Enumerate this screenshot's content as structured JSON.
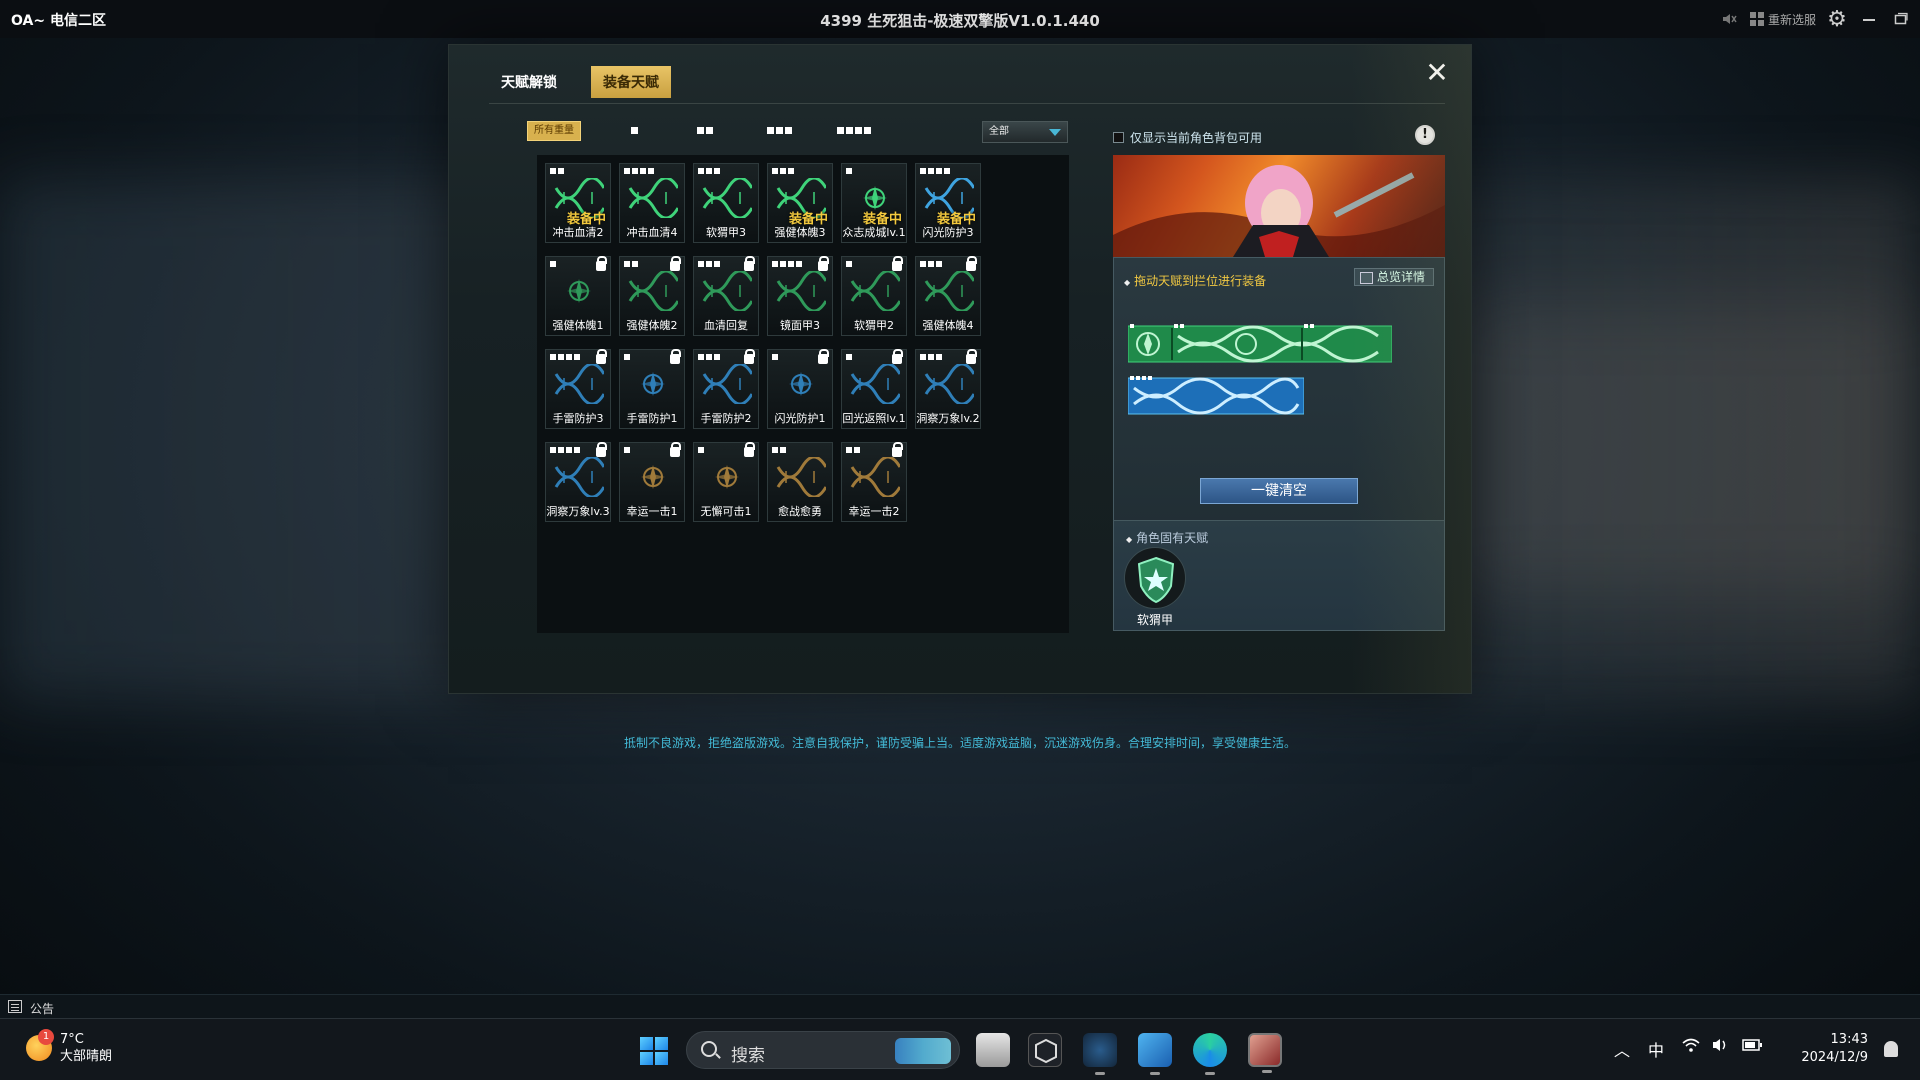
{
  "titlebar": {
    "server": "OA~ 电信二区",
    "title": "4399 生死狙击-极速双擎版V1.0.1.440",
    "reselect": "重新选服",
    "icons": [
      "mute-icon",
      "grid-icon",
      "gear-icon",
      "minimize-icon",
      "restore-icon"
    ]
  },
  "dialog": {
    "tabs": [
      {
        "label": "天赋解锁",
        "active": false
      },
      {
        "label": "装备天赋",
        "active": true
      }
    ],
    "close": "✕",
    "filter_all": "所有重量",
    "filter_levels": [
      1,
      2,
      3,
      4
    ],
    "select_value": "全部",
    "checkbox_label": "仅显示当前角色背包可用",
    "equipped_label": "装备中",
    "talents": [
      {
        "name": "冲击血清2",
        "level": 2,
        "equipped": true,
        "locked": false,
        "shape": "helix",
        "color": "#3fd37a"
      },
      {
        "name": "冲击血清4",
        "level": 4,
        "equipped": false,
        "locked": false,
        "shape": "helix",
        "color": "#3fd37a"
      },
      {
        "name": "软猬甲3",
        "level": 3,
        "equipped": false,
        "locked": false,
        "shape": "helix",
        "color": "#3fd37a"
      },
      {
        "name": "强健体魄3",
        "level": 3,
        "equipped": true,
        "locked": false,
        "shape": "helix",
        "color": "#3fd37a"
      },
      {
        "name": "众志成城lv.1",
        "level": 1,
        "equipped": true,
        "locked": false,
        "shape": "gear",
        "color": "#3fd37a"
      },
      {
        "name": "闪光防护3",
        "level": 4,
        "equipped": true,
        "locked": false,
        "shape": "helix",
        "color": "#3fa4e0"
      },
      {
        "name": "强健体魄1",
        "level": 1,
        "equipped": false,
        "locked": true,
        "shape": "gear",
        "color": "#2f9a5a"
      },
      {
        "name": "强健体魄2",
        "level": 2,
        "equipped": false,
        "locked": true,
        "shape": "helix",
        "color": "#2f9a5a"
      },
      {
        "name": "血清回复",
        "level": 3,
        "equipped": false,
        "locked": true,
        "shape": "helix",
        "color": "#2f9a5a"
      },
      {
        "name": "镜面甲3",
        "level": 4,
        "equipped": false,
        "locked": true,
        "shape": "helix",
        "color": "#2f9a5a"
      },
      {
        "name": "软猬甲2",
        "level": 1,
        "equipped": false,
        "locked": true,
        "shape": "helix",
        "color": "#2f9a5a"
      },
      {
        "name": "强健体魄4",
        "level": 3,
        "equipped": false,
        "locked": true,
        "shape": "helix",
        "color": "#2f9a5a"
      },
      {
        "name": "手雷防护3",
        "level": 4,
        "equipped": false,
        "locked": true,
        "shape": "helix",
        "color": "#2f7fb8"
      },
      {
        "name": "手雷防护1",
        "level": 1,
        "equipped": false,
        "locked": true,
        "shape": "gear",
        "color": "#2f7fb8"
      },
      {
        "name": "手雷防护2",
        "level": 3,
        "equipped": false,
        "locked": true,
        "shape": "helix",
        "color": "#2f7fb8"
      },
      {
        "name": "闪光防护1",
        "level": 1,
        "equipped": false,
        "locked": true,
        "shape": "gear",
        "color": "#2f7fb8"
      },
      {
        "name": "回光返照lv.1",
        "level": 1,
        "equipped": false,
        "locked": true,
        "shape": "helix",
        "color": "#2f7fb8"
      },
      {
        "name": "洞察万象lv.2",
        "level": 3,
        "equipped": false,
        "locked": true,
        "shape": "helix",
        "color": "#2f7fb8"
      },
      {
        "name": "洞察万象lv.3",
        "level": 4,
        "equipped": false,
        "locked": true,
        "shape": "helix",
        "color": "#2f7fb8"
      },
      {
        "name": "幸运一击1",
        "level": 1,
        "equipped": false,
        "locked": true,
        "shape": "gear",
        "color": "#a07a3a"
      },
      {
        "name": "无懈可击1",
        "level": 1,
        "equipped": false,
        "locked": true,
        "shape": "gear",
        "color": "#a07a3a"
      },
      {
        "name": "愈战愈勇",
        "level": 2,
        "equipped": false,
        "locked": false,
        "shape": "helix",
        "color": "#a07a3a"
      },
      {
        "name": "幸运一击2",
        "level": 2,
        "equipped": false,
        "locked": true,
        "shape": "helix",
        "color": "#a07a3a"
      }
    ],
    "drag_hint": "拖动天赋到拦位进行装备",
    "overview": "总览详情",
    "clear_all": "一键清空",
    "inherent_label": "角色固有天赋",
    "inherent_name": "软猬甲",
    "colors": {
      "gold": "#d8b14e",
      "green": "#3fd37a",
      "blue": "#3fa4e0",
      "accent_text": "#f1c842"
    }
  },
  "notice": "抵制不良游戏，拒绝盗版游戏。注意自我保护，谨防受骗上当。适度游戏益脑，沉迷游戏伤身。合理安排时间，享受健康生活。",
  "announcement": "公告",
  "taskbar": {
    "weather_temp": "7°C",
    "weather_desc": "大部晴朗",
    "weather_badge": "1",
    "search_placeholder": "搜索",
    "ime": "中",
    "time": "13:43",
    "date": "2024/12/9"
  }
}
